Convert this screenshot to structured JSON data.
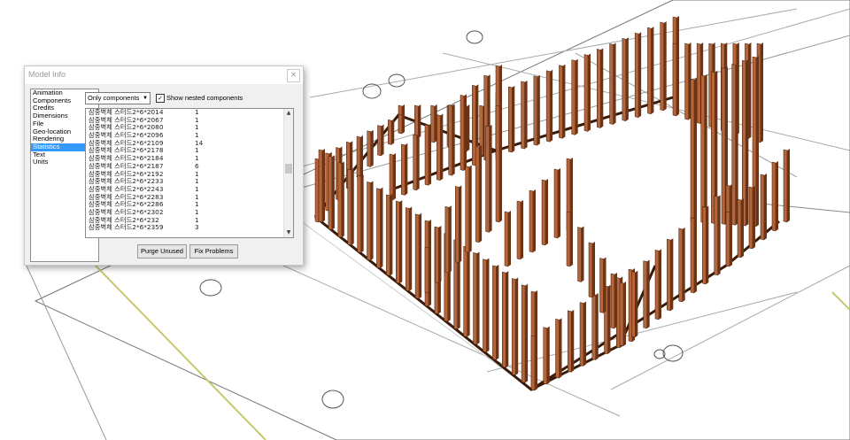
{
  "dialog": {
    "title": "Model Info",
    "close_glyph": "×",
    "categories": [
      "Animation",
      "Components",
      "Credits",
      "Dimensions",
      "File",
      "Geo-location",
      "Rendering",
      "Statistics",
      "Text",
      "Units"
    ],
    "selected_category": "Statistics",
    "filter_value": "Only components",
    "show_nested_label": "Show nested components",
    "show_nested_checked": true,
    "rows": [
      {
        "name": "삼중벽체 스터드2*6*2014",
        "count": "1"
      },
      {
        "name": "삼중벽체 스터드2*6*2067",
        "count": "1"
      },
      {
        "name": "삼중벽체 스터드2*6*2080",
        "count": "1"
      },
      {
        "name": "삼중벽체 스터드2*6*2096",
        "count": "1"
      },
      {
        "name": "삼중벽체 스터드2*6*2109",
        "count": "14"
      },
      {
        "name": "삼중벽체 스터드2*6*2178",
        "count": "1"
      },
      {
        "name": "삼중벽체 스터드2*6*2184",
        "count": "1"
      },
      {
        "name": "삼중벽체 스터드2*6*2187",
        "count": "6"
      },
      {
        "name": "삼중벽체 스터드2*6*2192",
        "count": "1"
      },
      {
        "name": "삼중벽체 스터드2*6*2233",
        "count": "1"
      },
      {
        "name": "삼중벽체 스터드2*6*2243",
        "count": "1"
      },
      {
        "name": "삼중벽체 스터드2*6*2283",
        "count": "1"
      },
      {
        "name": "삼중벽체 스터드2*6*2286",
        "count": "1"
      },
      {
        "name": "삼중벽체 스터드2*6*2302",
        "count": "1"
      },
      {
        "name": "삼중벽체 스터드2*6*232",
        "count": "1"
      },
      {
        "name": "삼중벽체 스터드2*6*2359",
        "count": "3"
      }
    ],
    "purge_label": "Purge Unused",
    "fix_label": "Fix Problems"
  },
  "colors": {
    "stud_front": "#b5653a",
    "stud_side": "#6b3417",
    "selection": "#3399ff",
    "ground_edge": "#c8c86e"
  }
}
